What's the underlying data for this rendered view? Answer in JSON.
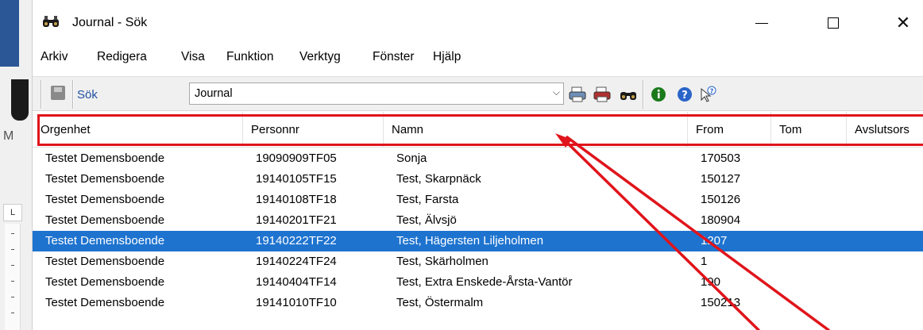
{
  "window": {
    "title": "Journal - Sök",
    "icon": "binoculars-icon"
  },
  "menu": [
    "Arkiv",
    "Redigera",
    "Visa",
    "Funktion",
    "Verktyg",
    "Fönster",
    "Hjälp"
  ],
  "toolbar": {
    "search_label": "Sök",
    "combo_value": "Journal",
    "icons": [
      "print-icon",
      "print-all-icon",
      "binoculars-icon",
      "info-icon",
      "help-icon",
      "whats-this-icon"
    ]
  },
  "list": {
    "columns": [
      "Orgenhet",
      "Personnr",
      "Namn",
      "From",
      "Tom",
      "Avslutsors"
    ],
    "rows": [
      [
        "Testet Demensboende",
        "19090909TF05",
        "Sonja",
        "170503",
        ""
      ],
      [
        "Testet Demensboende",
        "19140105TF15",
        "Test, Skarpnäck",
        "150127",
        ""
      ],
      [
        "Testet Demensboende",
        "19140108TF18",
        "Test, Farsta",
        "150126",
        ""
      ],
      [
        "Testet Demensboende",
        "19140201TF21",
        "Test, Älvsjö",
        "180904",
        ""
      ],
      [
        "Testet Demensboende",
        "19140222TF22",
        "Test, Hägersten Liljeholmen",
        "1207",
        ""
      ],
      [
        "Testet Demensboende",
        "19140224TF24",
        "Test, Skärholmen",
        "1",
        ""
      ],
      [
        "Testet Demensboende",
        "19140404TF14",
        "Test, Extra Enskede-Årsta-Vantör",
        "190",
        ""
      ],
      [
        "Testet Demensboende",
        "19141010TF10",
        "Test, Östermalm",
        "150213",
        ""
      ]
    ],
    "selected_index": 4
  },
  "background": {
    "left_letter": "M",
    "ruler_letter": "L"
  },
  "colors": {
    "selection": "#1e73cf",
    "annotation": "#e0141b"
  }
}
